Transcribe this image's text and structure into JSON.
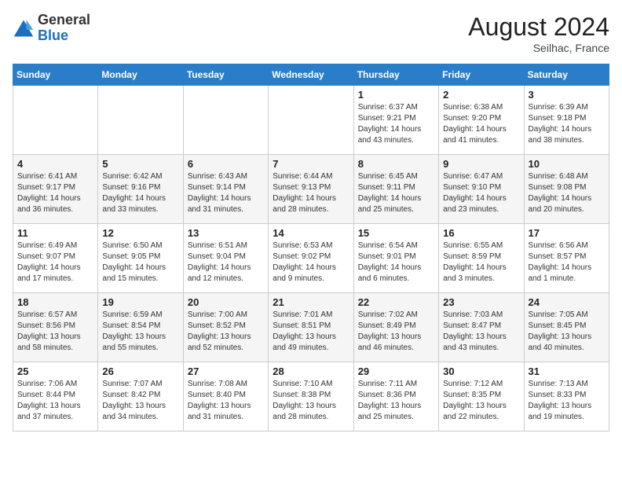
{
  "header": {
    "logo_general": "General",
    "logo_blue": "Blue",
    "month_year": "August 2024",
    "location": "Seilhac, France"
  },
  "days_of_week": [
    "Sunday",
    "Monday",
    "Tuesday",
    "Wednesday",
    "Thursday",
    "Friday",
    "Saturday"
  ],
  "weeks": [
    [
      {
        "day": "",
        "info": ""
      },
      {
        "day": "",
        "info": ""
      },
      {
        "day": "",
        "info": ""
      },
      {
        "day": "",
        "info": ""
      },
      {
        "day": "1",
        "info": "Sunrise: 6:37 AM\nSunset: 9:21 PM\nDaylight: 14 hours\nand 43 minutes."
      },
      {
        "day": "2",
        "info": "Sunrise: 6:38 AM\nSunset: 9:20 PM\nDaylight: 14 hours\nand 41 minutes."
      },
      {
        "day": "3",
        "info": "Sunrise: 6:39 AM\nSunset: 9:18 PM\nDaylight: 14 hours\nand 38 minutes."
      }
    ],
    [
      {
        "day": "4",
        "info": "Sunrise: 6:41 AM\nSunset: 9:17 PM\nDaylight: 14 hours\nand 36 minutes."
      },
      {
        "day": "5",
        "info": "Sunrise: 6:42 AM\nSunset: 9:16 PM\nDaylight: 14 hours\nand 33 minutes."
      },
      {
        "day": "6",
        "info": "Sunrise: 6:43 AM\nSunset: 9:14 PM\nDaylight: 14 hours\nand 31 minutes."
      },
      {
        "day": "7",
        "info": "Sunrise: 6:44 AM\nSunset: 9:13 PM\nDaylight: 14 hours\nand 28 minutes."
      },
      {
        "day": "8",
        "info": "Sunrise: 6:45 AM\nSunset: 9:11 PM\nDaylight: 14 hours\nand 25 minutes."
      },
      {
        "day": "9",
        "info": "Sunrise: 6:47 AM\nSunset: 9:10 PM\nDaylight: 14 hours\nand 23 minutes."
      },
      {
        "day": "10",
        "info": "Sunrise: 6:48 AM\nSunset: 9:08 PM\nDaylight: 14 hours\nand 20 minutes."
      }
    ],
    [
      {
        "day": "11",
        "info": "Sunrise: 6:49 AM\nSunset: 9:07 PM\nDaylight: 14 hours\nand 17 minutes."
      },
      {
        "day": "12",
        "info": "Sunrise: 6:50 AM\nSunset: 9:05 PM\nDaylight: 14 hours\nand 15 minutes."
      },
      {
        "day": "13",
        "info": "Sunrise: 6:51 AM\nSunset: 9:04 PM\nDaylight: 14 hours\nand 12 minutes."
      },
      {
        "day": "14",
        "info": "Sunrise: 6:53 AM\nSunset: 9:02 PM\nDaylight: 14 hours\nand 9 minutes."
      },
      {
        "day": "15",
        "info": "Sunrise: 6:54 AM\nSunset: 9:01 PM\nDaylight: 14 hours\nand 6 minutes."
      },
      {
        "day": "16",
        "info": "Sunrise: 6:55 AM\nSunset: 8:59 PM\nDaylight: 14 hours\nand 3 minutes."
      },
      {
        "day": "17",
        "info": "Sunrise: 6:56 AM\nSunset: 8:57 PM\nDaylight: 14 hours\nand 1 minute."
      }
    ],
    [
      {
        "day": "18",
        "info": "Sunrise: 6:57 AM\nSunset: 8:56 PM\nDaylight: 13 hours\nand 58 minutes."
      },
      {
        "day": "19",
        "info": "Sunrise: 6:59 AM\nSunset: 8:54 PM\nDaylight: 13 hours\nand 55 minutes."
      },
      {
        "day": "20",
        "info": "Sunrise: 7:00 AM\nSunset: 8:52 PM\nDaylight: 13 hours\nand 52 minutes."
      },
      {
        "day": "21",
        "info": "Sunrise: 7:01 AM\nSunset: 8:51 PM\nDaylight: 13 hours\nand 49 minutes."
      },
      {
        "day": "22",
        "info": "Sunrise: 7:02 AM\nSunset: 8:49 PM\nDaylight: 13 hours\nand 46 minutes."
      },
      {
        "day": "23",
        "info": "Sunrise: 7:03 AM\nSunset: 8:47 PM\nDaylight: 13 hours\nand 43 minutes."
      },
      {
        "day": "24",
        "info": "Sunrise: 7:05 AM\nSunset: 8:45 PM\nDaylight: 13 hours\nand 40 minutes."
      }
    ],
    [
      {
        "day": "25",
        "info": "Sunrise: 7:06 AM\nSunset: 8:44 PM\nDaylight: 13 hours\nand 37 minutes."
      },
      {
        "day": "26",
        "info": "Sunrise: 7:07 AM\nSunset: 8:42 PM\nDaylight: 13 hours\nand 34 minutes."
      },
      {
        "day": "27",
        "info": "Sunrise: 7:08 AM\nSunset: 8:40 PM\nDaylight: 13 hours\nand 31 minutes."
      },
      {
        "day": "28",
        "info": "Sunrise: 7:10 AM\nSunset: 8:38 PM\nDaylight: 13 hours\nand 28 minutes."
      },
      {
        "day": "29",
        "info": "Sunrise: 7:11 AM\nSunset: 8:36 PM\nDaylight: 13 hours\nand 25 minutes."
      },
      {
        "day": "30",
        "info": "Sunrise: 7:12 AM\nSunset: 8:35 PM\nDaylight: 13 hours\nand 22 minutes."
      },
      {
        "day": "31",
        "info": "Sunrise: 7:13 AM\nSunset: 8:33 PM\nDaylight: 13 hours\nand 19 minutes."
      }
    ]
  ]
}
